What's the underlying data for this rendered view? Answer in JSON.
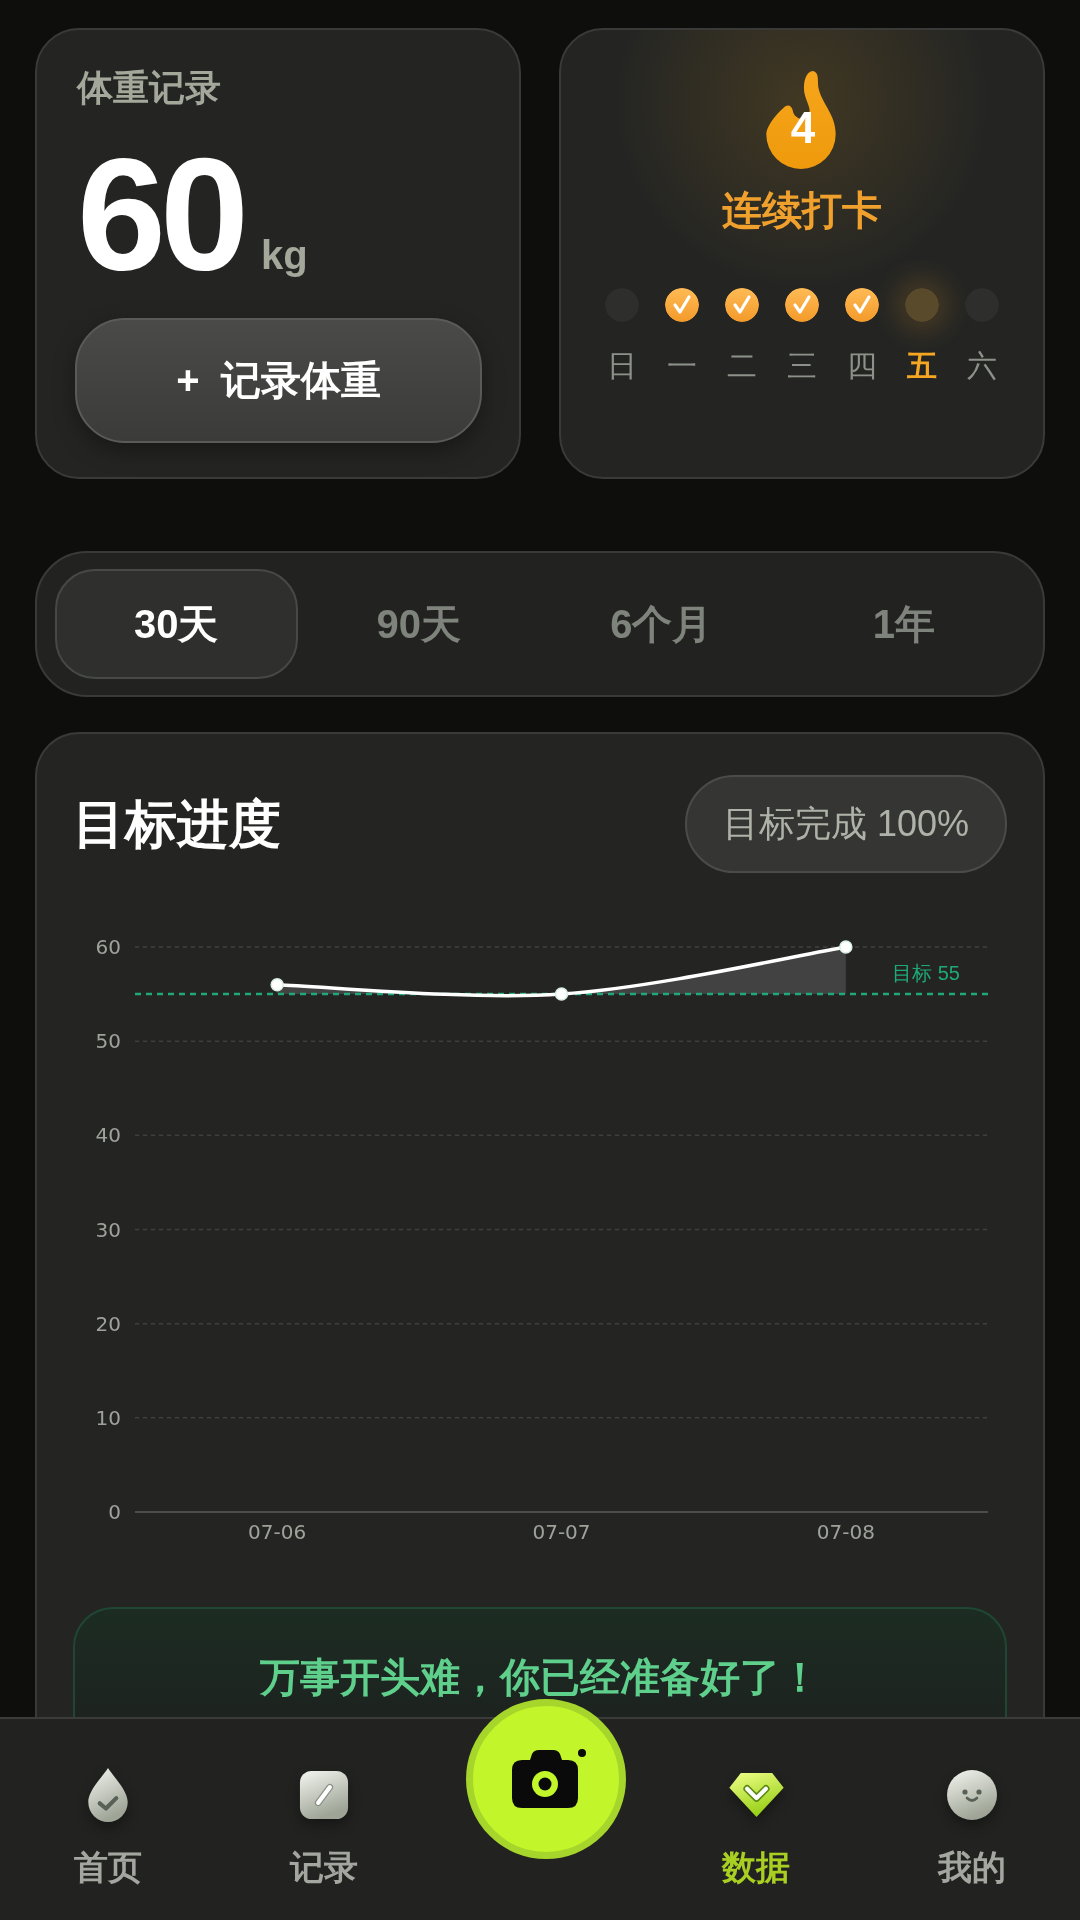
{
  "weight_card": {
    "title": "体重记录",
    "value": "60",
    "unit": "kg",
    "button": "+ 记录体重"
  },
  "streak_card": {
    "count": "4",
    "title": "连续打卡",
    "days": [
      {
        "label": "日",
        "checked": false,
        "today": false
      },
      {
        "label": "一",
        "checked": true,
        "today": false
      },
      {
        "label": "二",
        "checked": true,
        "today": false
      },
      {
        "label": "三",
        "checked": true,
        "today": false
      },
      {
        "label": "四",
        "checked": true,
        "today": false
      },
      {
        "label": "五",
        "checked": false,
        "today": true
      },
      {
        "label": "六",
        "checked": false,
        "today": false
      }
    ]
  },
  "range_tabs": [
    {
      "label": "30天",
      "selected": true
    },
    {
      "label": "90天",
      "selected": false
    },
    {
      "label": "6个月",
      "selected": false
    },
    {
      "label": "1年",
      "selected": false
    }
  ],
  "progress_card": {
    "title": "目标进度",
    "badge": "目标完成 100%",
    "chart_data": {
      "type": "line",
      "categories": [
        "07-06",
        "07-07",
        "07-08"
      ],
      "values": [
        56,
        55,
        60
      ],
      "ylim": [
        0,
        60
      ],
      "yticks": [
        0,
        10,
        20,
        30,
        40,
        50,
        60
      ],
      "grid": true,
      "marker": "circle",
      "ref_lines": [
        {
          "axis": "y",
          "value": 55,
          "label": "目标 55",
          "color": "#1fa97a"
        }
      ]
    },
    "message": "万事开头难，你已经准备好了！"
  },
  "bottom_nav": [
    {
      "kind": "tab",
      "label": "首页",
      "selected": false
    },
    {
      "kind": "tab",
      "label": "记录",
      "selected": false
    },
    {
      "kind": "camera"
    },
    {
      "kind": "tab",
      "label": "数据",
      "selected": true
    },
    {
      "kind": "tab",
      "label": "我的",
      "selected": false
    }
  ]
}
